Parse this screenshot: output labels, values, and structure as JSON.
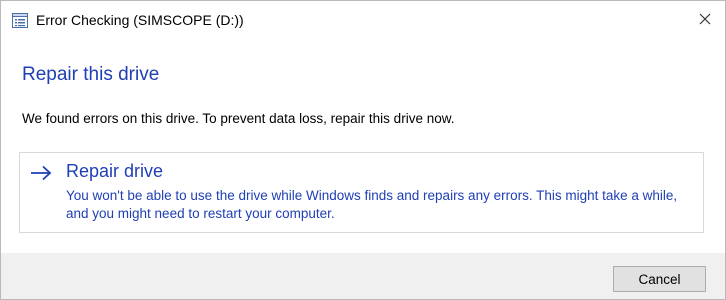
{
  "window": {
    "title": "Error Checking (SIMSCOPE (D:))",
    "icon": "drive-list-icon",
    "close_icon": "close-icon"
  },
  "content": {
    "heading": "Repair this drive",
    "message": "We found errors on this drive. To prevent data loss, repair this drive now."
  },
  "command_link": {
    "icon": "arrow-right-icon",
    "title": "Repair drive",
    "description": "You won't be able to use the drive while Windows finds and repairs any errors. This might take a while, and you might need to restart your computer."
  },
  "footer": {
    "cancel_label": "Cancel"
  },
  "colors": {
    "accent": "#1f3fb5",
    "footer_background": "#f0f0f0"
  }
}
